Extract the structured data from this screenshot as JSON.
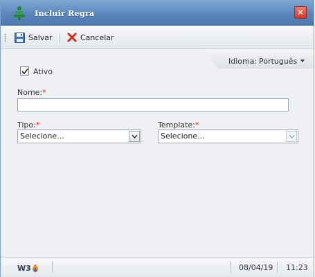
{
  "window": {
    "title": "Incluir Regra",
    "logo_icon": "w3-tree-logo-icon",
    "close_icon": "close-icon",
    "close_label": "✕"
  },
  "toolbar": {
    "save_label": "Salvar",
    "save_icon": "floppy-disk-icon",
    "cancel_label": "Cancelar",
    "cancel_icon": "red-x-icon"
  },
  "language": {
    "label": "Idioma:",
    "value": "Português"
  },
  "form": {
    "ativo": {
      "label": "Ativo",
      "checked": true
    },
    "nome": {
      "label": "Nome:",
      "required_mark": "*",
      "value": ""
    },
    "tipo": {
      "label": "Tipo:",
      "required_mark": "*",
      "selected": "Selecione..."
    },
    "template": {
      "label": "Template:",
      "required_mark": "*",
      "selected": "Selecione..."
    }
  },
  "statusbar": {
    "logo_text": "W3",
    "date": "08/04/19",
    "time": "11:23"
  },
  "colors": {
    "titlebar": "#5a86bd",
    "required": "#d8261c",
    "close": "#d13a26",
    "background": "#eef0f3"
  }
}
